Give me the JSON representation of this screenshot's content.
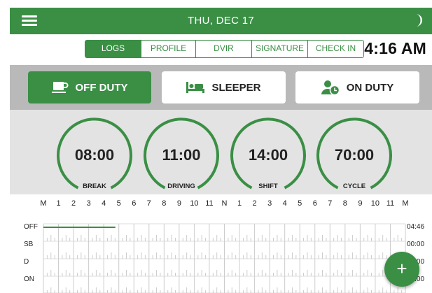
{
  "header": {
    "date": "THU, DEC 17",
    "menu_icon": "hamburger-menu-icon",
    "theme_icon": "moon-icon"
  },
  "tabs": [
    {
      "label": "LOGS",
      "active": true
    },
    {
      "label": "PROFILE",
      "active": false
    },
    {
      "label": "DVIR",
      "active": false
    },
    {
      "label": "SIGNATURE",
      "active": false
    },
    {
      "label": "CHECK IN",
      "active": false
    }
  ],
  "clock": "4:16 AM",
  "status_buttons": [
    {
      "label": "OFF DUTY",
      "icon": "coffee-cup-icon",
      "selected": true
    },
    {
      "label": "SLEEPER",
      "icon": "bed-icon",
      "selected": false
    },
    {
      "label": "ON DUTY",
      "icon": "person-clock-icon",
      "selected": false
    }
  ],
  "timers": [
    {
      "value": "08:00",
      "label": "BREAK"
    },
    {
      "value": "11:00",
      "label": "DRIVING"
    },
    {
      "value": "14:00",
      "label": "SHIFT"
    },
    {
      "value": "70:00",
      "label": "CYCLE"
    }
  ],
  "log_grid": {
    "hour_labels": [
      "M",
      "1",
      "2",
      "3",
      "4",
      "5",
      "6",
      "7",
      "8",
      "9",
      "10",
      "11",
      "N",
      "1",
      "2",
      "3",
      "4",
      "5",
      "6",
      "7",
      "8",
      "9",
      "10",
      "11",
      "M"
    ],
    "rows": [
      {
        "label": "OFF",
        "total": "04:46"
      },
      {
        "label": "SB",
        "total": "00:00"
      },
      {
        "label": "D",
        "total": "00:00"
      },
      {
        "label": "ON",
        "total": "00:00"
      }
    ],
    "duty_line": {
      "row": "OFF",
      "start_hour": 0,
      "end_hour": 4.77
    }
  },
  "fab": {
    "label": "+"
  },
  "colors": {
    "primary": "#3a8f45",
    "status_bg": "#b9b9b9",
    "timers_bg": "#e3e3e3"
  }
}
